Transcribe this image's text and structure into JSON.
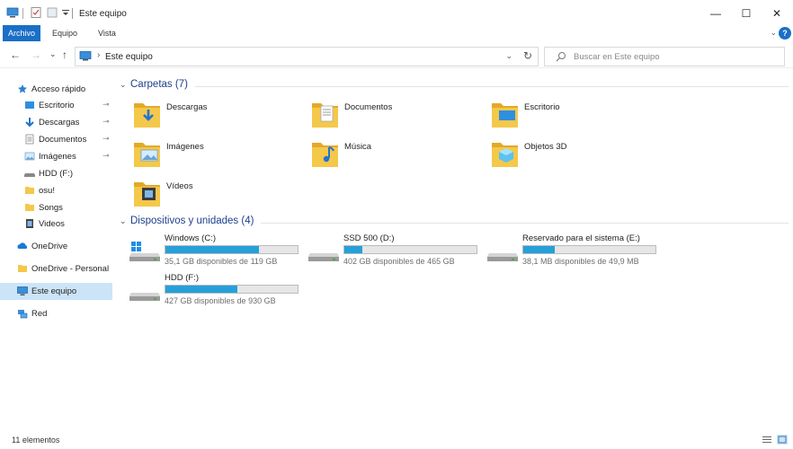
{
  "window": {
    "title": "Este equipo",
    "minimize_glyph": "—",
    "maximize_glyph": "☐",
    "close_glyph": "✕"
  },
  "ribbon": {
    "tabs": [
      "Archivo",
      "Equipo",
      "Vista"
    ],
    "active_tab": "Archivo",
    "collapse_glyph": "⌄",
    "help_glyph": "?"
  },
  "navigation": {
    "back_glyph": "←",
    "forward_glyph": "→",
    "recent_glyph": "⌄",
    "up_glyph": "↑",
    "address_separator": "›",
    "address": "Este equipo",
    "address_dropdown_glyph": "⌄",
    "refresh_glyph": "↻",
    "search_placeholder": "Buscar en Este equipo"
  },
  "sidebar": {
    "pin_glyph": "📌",
    "items": [
      {
        "label": "Acceso rápido",
        "icon": "star-icon"
      },
      {
        "label": "Escritorio",
        "icon": "desktop-folder-icon",
        "pinned": true
      },
      {
        "label": "Descargas",
        "icon": "downloads-icon",
        "pinned": true
      },
      {
        "label": "Documentos",
        "icon": "documents-icon",
        "pinned": true
      },
      {
        "label": "Imágenes",
        "icon": "pictures-icon",
        "pinned": true
      },
      {
        "label": "HDD (F:)",
        "icon": "drive-icon"
      },
      {
        "label": "osu!",
        "icon": "folder-icon"
      },
      {
        "label": "Songs",
        "icon": "folder-icon"
      },
      {
        "label": "Videos",
        "icon": "videos-icon"
      },
      {
        "label": "OneDrive",
        "icon": "onedrive-icon"
      },
      {
        "label": "OneDrive - Personal",
        "icon": "folder-icon"
      },
      {
        "label": "Este equipo",
        "icon": "computer-icon",
        "selected": true
      },
      {
        "label": "Red",
        "icon": "network-icon"
      }
    ]
  },
  "content": {
    "folders_section_title": "Carpetas (7)",
    "drives_section_title": "Dispositivos y unidades (4)",
    "section_chevron": "⌄",
    "folders": [
      {
        "label": "Descargas",
        "icon": "downloads-folder-icon"
      },
      {
        "label": "Documentos",
        "icon": "documents-folder-icon"
      },
      {
        "label": "Escritorio",
        "icon": "desktop-folder-icon"
      },
      {
        "label": "Imágenes",
        "icon": "pictures-folder-icon"
      },
      {
        "label": "Música",
        "icon": "music-folder-icon"
      },
      {
        "label": "Objetos 3D",
        "icon": "3d-objects-folder-icon"
      },
      {
        "label": "Vídeos",
        "icon": "videos-folder-icon"
      }
    ],
    "drives": [
      {
        "label": "Windows (C:)",
        "info": "35,1 GB disponibles de 119 GB",
        "used_fraction": 0.705,
        "icon": "system-drive-icon"
      },
      {
        "label": "SSD 500 (D:)",
        "info": "402 GB disponibles de 465 GB",
        "used_fraction": 0.135,
        "icon": "drive-icon"
      },
      {
        "label": "Reservado para el sistema (E:)",
        "info": "38,1 MB disponibles de 49,9 MB",
        "used_fraction": 0.236,
        "icon": "drive-icon"
      },
      {
        "label": "HDD (F:)",
        "info": "427 GB disponibles de 930 GB",
        "used_fraction": 0.541,
        "icon": "drive-icon"
      }
    ]
  },
  "status": {
    "item_count": "11 elementos",
    "view": "large-icons"
  },
  "colors": {
    "accent": "#1a6fc7",
    "section_title": "#1e3f8c",
    "usage_bar": "#26a0da",
    "selection": "#cce4f7",
    "folder_yellow": "#f4c84a"
  }
}
